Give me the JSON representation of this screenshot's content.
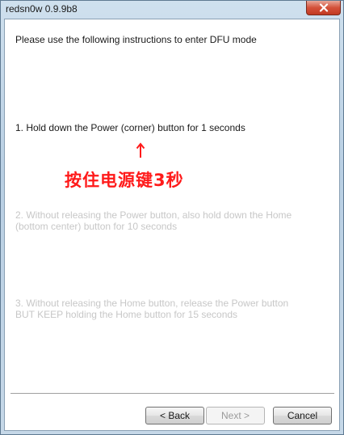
{
  "window": {
    "title": "redsn0w 0.9.9b8"
  },
  "instructions": {
    "intro": "Please use the following instructions to enter DFU mode",
    "step1": "1. Hold down the Power (corner) button for 1 seconds",
    "step2": "2. Without releasing the Power button, also hold down the Home\n(bottom center) button for 10 seconds",
    "step3": "3. Without releasing the Home button, release the Power button\nBUT KEEP holding the Home button for 15 seconds"
  },
  "annotation": {
    "text": "按住电源键3秒",
    "color": "#ff1a1a"
  },
  "buttons": {
    "back_label": "< Back",
    "next_label": "Next >",
    "cancel_label": "Cancel"
  }
}
